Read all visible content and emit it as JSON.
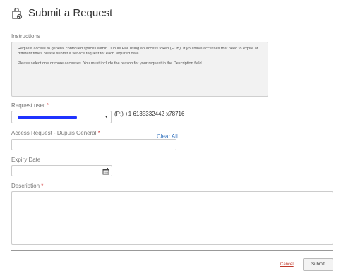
{
  "header": {
    "title": "Submit a Request",
    "icon": "request-lock-icon"
  },
  "instructions": {
    "label": "Instructions",
    "paragraph1": "Request access to general controlled spaces within Dupuis Hall using an access token (FOB). If you have accesses that need to expire at different times please submit a service request for each required date.",
    "paragraph2": "Please select one or more accesses.  You must include the reason for your request in the Description field."
  },
  "request_user": {
    "label": "Request user",
    "required_mark": "*",
    "phone": "(P:) +1 6135332442 x78716",
    "caret": "▼"
  },
  "access_request": {
    "label": "Access Request - Dupuis General",
    "required_mark": "*",
    "clear_all": "Clear All",
    "value": ""
  },
  "expiry_date": {
    "label": "Expiry Date",
    "value": "",
    "icon": "calendar-icon"
  },
  "description": {
    "label": "Description",
    "required_mark": "*",
    "value": ""
  },
  "footer": {
    "cancel_label": "Cancel",
    "submit_label": "Submit"
  }
}
